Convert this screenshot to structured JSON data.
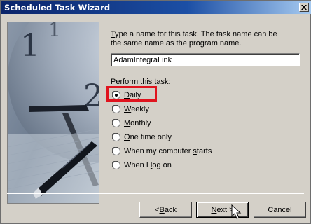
{
  "window": {
    "title": "Scheduled Task Wizard"
  },
  "intro": {
    "line1_pre": "",
    "line1_ul": "T",
    "line1_rest": "ype a name for this task.  The task name can be",
    "line2": "the same name as the program name."
  },
  "task_name": {
    "value": "AdamIntegraLink"
  },
  "perform": {
    "label": "Perform this task:",
    "options": [
      {
        "ul": "D",
        "rest": "aily",
        "pre": "",
        "selected": true
      },
      {
        "ul": "W",
        "rest": "eekly",
        "pre": "",
        "selected": false
      },
      {
        "ul": "M",
        "rest": "onthly",
        "pre": "",
        "selected": false
      },
      {
        "ul": "O",
        "rest": "ne time only",
        "pre": "",
        "selected": false
      },
      {
        "pre": "When my computer ",
        "ul": "s",
        "rest": "tarts",
        "selected": false
      },
      {
        "pre": "When I ",
        "ul": "l",
        "rest": "og on",
        "selected": false
      }
    ]
  },
  "buttons": {
    "back": {
      "pre": "< ",
      "ul": "B",
      "rest": "ack"
    },
    "next": {
      "pre": "",
      "ul": "N",
      "rest": "ext >"
    },
    "cancel": {
      "label": "Cancel"
    }
  },
  "colors": {
    "highlight": "#e0141e",
    "titlebar": "#0a246a"
  }
}
